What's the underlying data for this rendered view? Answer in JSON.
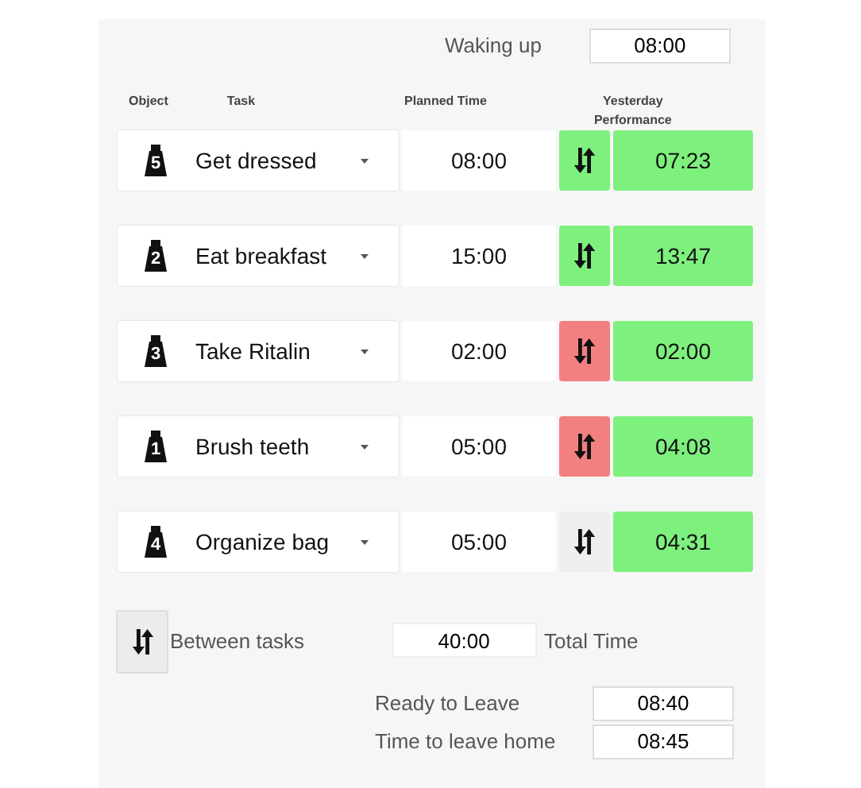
{
  "waking_up": {
    "label": "Waking up",
    "value": "08:00"
  },
  "columns": {
    "object": "Object",
    "task": "Task",
    "planned_time": "Planned Time",
    "yesterday": "Yesterday Performance"
  },
  "tasks": [
    {
      "object_number": "5",
      "task": "Get dressed",
      "planned_time": "08:00",
      "color": "#7ef07e",
      "yesterday": "07:23"
    },
    {
      "object_number": "2",
      "task": "Eat breakfast",
      "planned_time": "15:00",
      "color": "#7ef07e",
      "yesterday": "13:47"
    },
    {
      "object_number": "3",
      "task": "Take Ritalin",
      "planned_time": "02:00",
      "color": "#f28080",
      "yesterday": "02:00"
    },
    {
      "object_number": "1",
      "task": "Brush teeth",
      "planned_time": "05:00",
      "color": "#f28080",
      "yesterday": "04:08"
    },
    {
      "object_number": "4",
      "task": "Organize bag",
      "planned_time": "05:00",
      "color": "#efefef",
      "yesterday": "04:31"
    }
  ],
  "between_tasks": {
    "label": "Between tasks"
  },
  "total_time": {
    "value": "40:00",
    "label": "Total Time"
  },
  "ready_to_leave": {
    "label": "Ready to Leave",
    "value": "08:40"
  },
  "time_to_leave_home": {
    "label": "Time to leave home",
    "value": "08:45"
  }
}
